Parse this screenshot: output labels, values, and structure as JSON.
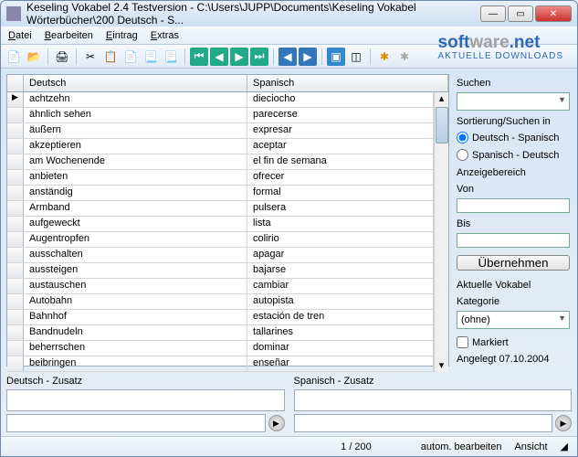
{
  "title": "Keseling Vokabel 2.4 Testversion - C:\\Users\\JUPP\\Documents\\Keseling Vokabel Wörterbücher\\200 Deutsch - S...",
  "menu": {
    "file": "Datei",
    "edit": "Bearbeiten",
    "entry": "Eintrag",
    "extras": "Extras"
  },
  "watermark": {
    "brand1": "soft",
    "brand2": "ware",
    "brand3": ".net",
    "sub": "AKTUELLE DOWNLOADS"
  },
  "columns": {
    "left": "Deutsch",
    "right": "Spanisch"
  },
  "rows": [
    {
      "de": "achtzehn",
      "es": "dieciocho"
    },
    {
      "de": "ähnlich sehen",
      "es": "parecerse"
    },
    {
      "de": "äußern",
      "es": "expresar"
    },
    {
      "de": "akzeptieren",
      "es": "aceptar"
    },
    {
      "de": "am Wochenende",
      "es": "el fin de semana"
    },
    {
      "de": "anbieten",
      "es": "ofrecer"
    },
    {
      "de": "anständig",
      "es": "formal"
    },
    {
      "de": "Armband",
      "es": "pulsera"
    },
    {
      "de": "aufgeweckt",
      "es": "lista"
    },
    {
      "de": "Augentropfen",
      "es": "colirio"
    },
    {
      "de": "ausschalten",
      "es": "apagar"
    },
    {
      "de": "aussteigen",
      "es": "bajarse"
    },
    {
      "de": "austauschen",
      "es": "cambiar"
    },
    {
      "de": "Autobahn",
      "es": "autopista"
    },
    {
      "de": "Bahnhof",
      "es": "estación de tren"
    },
    {
      "de": "Bandnudeln",
      "es": "tallarines"
    },
    {
      "de": "beherrschen",
      "es": "dominar"
    },
    {
      "de": "beibringen",
      "es": "enseñar"
    }
  ],
  "side": {
    "search": "Suchen",
    "sortIn": "Sortierung/Suchen in",
    "r1": "Deutsch - Spanisch",
    "r2": "Spanisch - Deutsch",
    "range": "Anzeigebereich",
    "from": "Von",
    "to": "Bis",
    "apply": "Übernehmen",
    "current": "Aktuelle Vokabel",
    "category": "Kategorie",
    "catValue": "(ohne)",
    "marked": "Markiert",
    "created": "Angelegt 07.10.2004"
  },
  "zusatz": {
    "left": "Deutsch - Zusatz",
    "right": "Spanisch - Zusatz"
  },
  "status": {
    "counter": "1 / 200",
    "auto": "autom. bearbeiten",
    "view": "Ansicht"
  }
}
